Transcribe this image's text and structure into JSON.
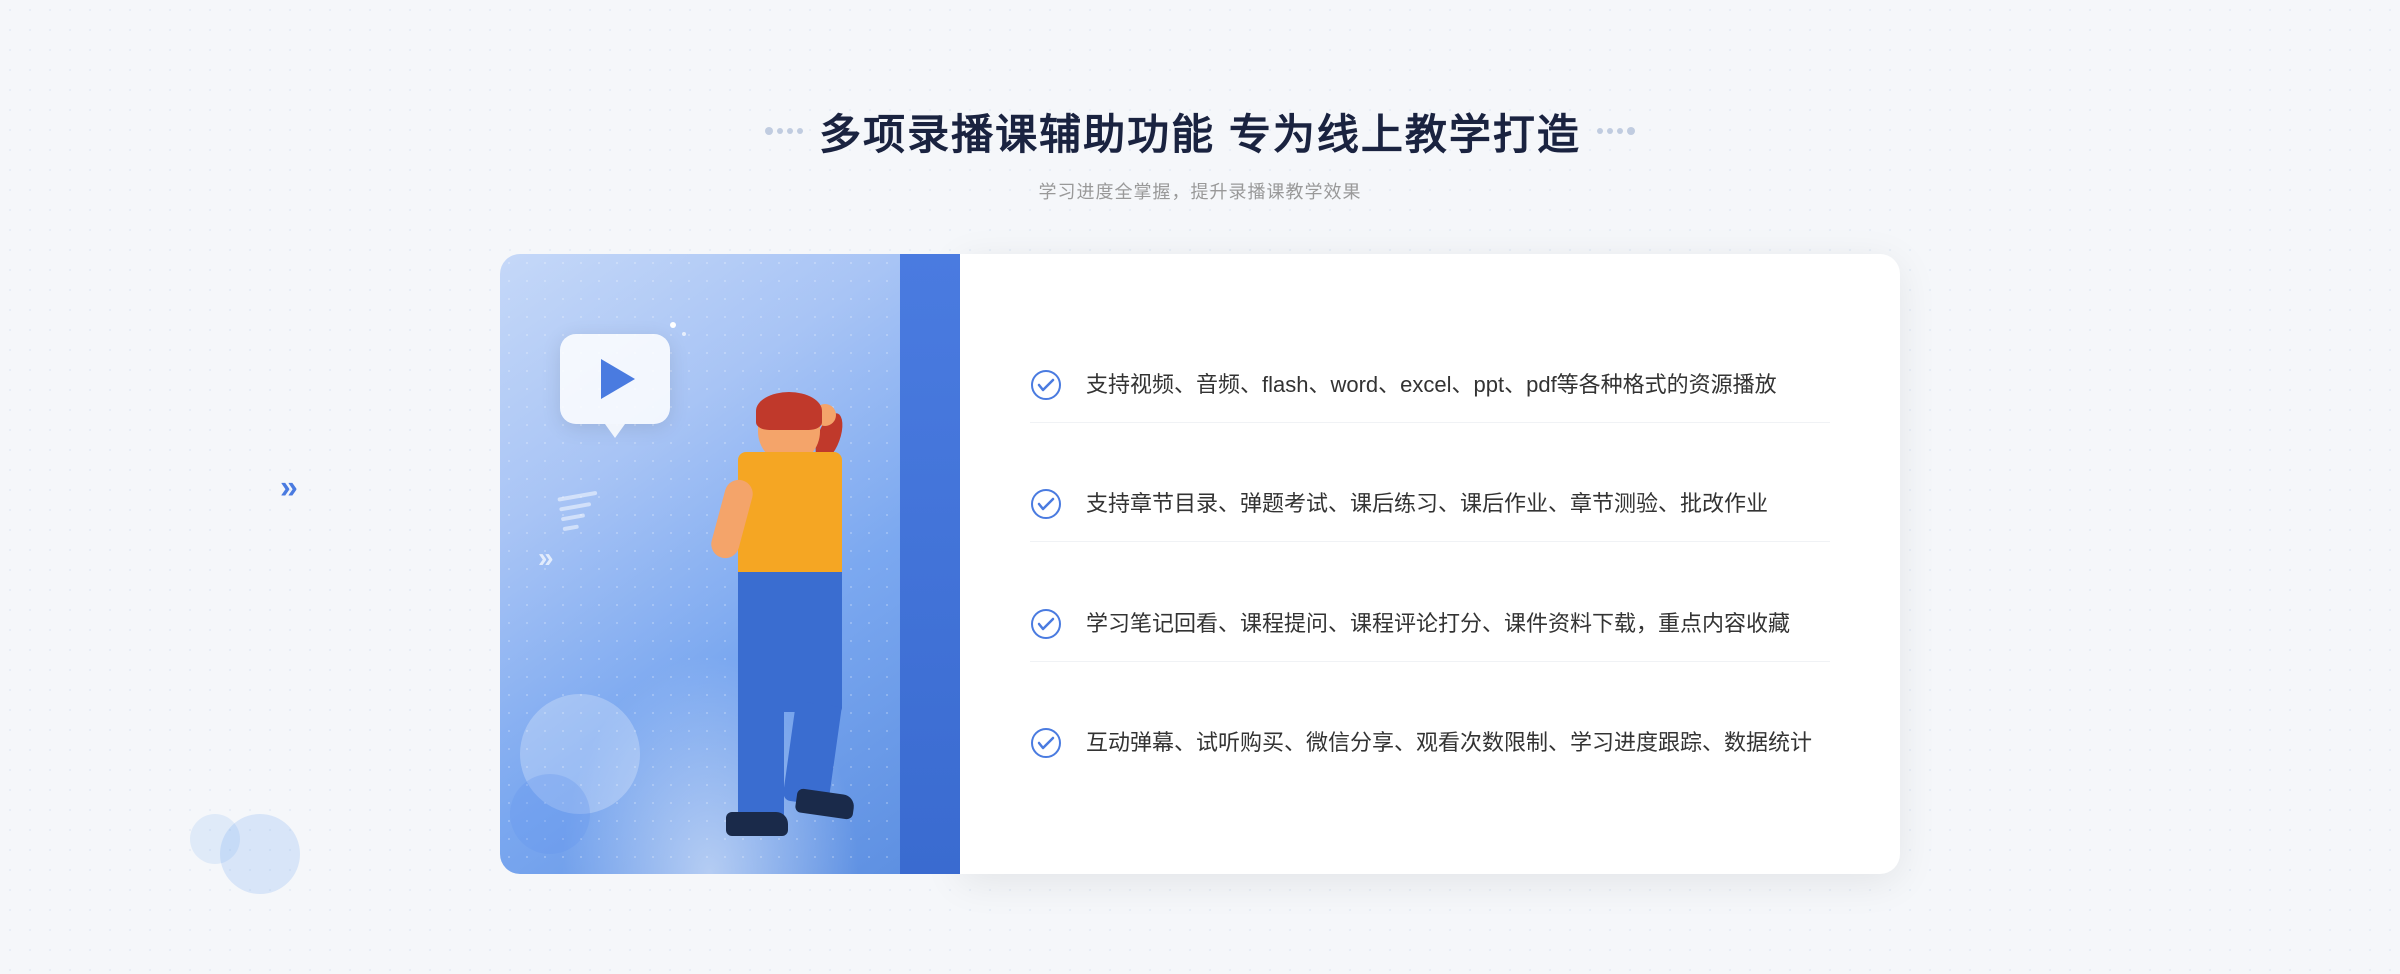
{
  "header": {
    "title": "多项录播课辅助功能 专为线上教学打造",
    "subtitle": "学习进度全掌握，提升录播课教学效果"
  },
  "features": [
    {
      "id": "feature-1",
      "text": "支持视频、音频、flash、word、excel、ppt、pdf等各种格式的资源播放"
    },
    {
      "id": "feature-2",
      "text": "支持章节目录、弹题考试、课后练习、课后作业、章节测验、批改作业"
    },
    {
      "id": "feature-3",
      "text": "学习笔记回看、课程提问、课程评论打分、课件资料下载，重点内容收藏"
    },
    {
      "id": "feature-4",
      "text": "互动弹幕、试听购买、微信分享、观看次数限制、学习进度跟踪、数据统计"
    }
  ],
  "decoration": {
    "arrow_left": "»"
  }
}
